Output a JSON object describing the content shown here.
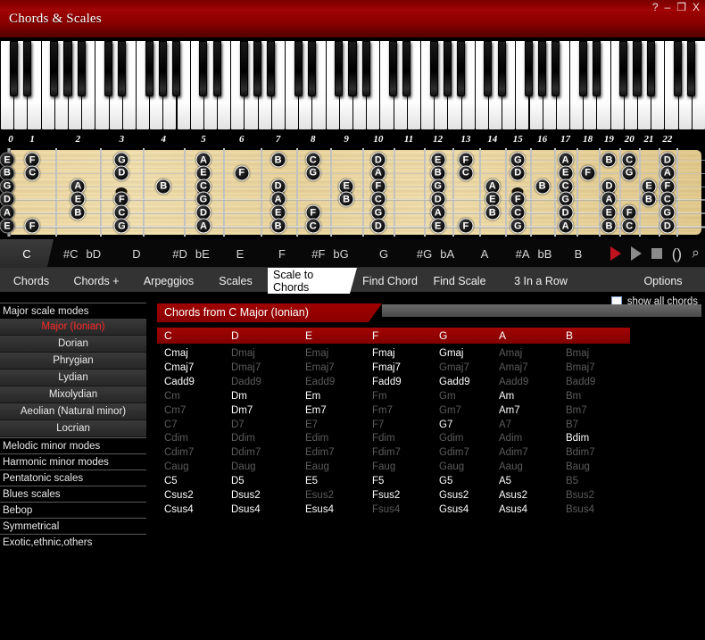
{
  "window": {
    "title": "Chords & Scales",
    "buttons": [
      {
        "name": "help-button",
        "glyph": "?"
      },
      {
        "name": "minimize-button",
        "glyph": "–"
      },
      {
        "name": "maximize-button",
        "glyph": "❐"
      },
      {
        "name": "close-button",
        "glyph": "X"
      }
    ]
  },
  "fretboard": {
    "fret_numbers": [
      "0",
      "1",
      "2",
      "3",
      "4",
      "5",
      "6",
      "7",
      "8",
      "9",
      "10",
      "11",
      "12",
      "13",
      "14",
      "15",
      "16",
      "17",
      "18",
      "19",
      "20",
      "21",
      "22"
    ],
    "strings": [
      "E",
      "B",
      "G",
      "D",
      "A",
      "E"
    ],
    "notes": [
      {
        "string": 0,
        "fret": 0,
        "label": "E"
      },
      {
        "string": 1,
        "fret": 0,
        "label": "B"
      },
      {
        "string": 2,
        "fret": 0,
        "label": "G"
      },
      {
        "string": 3,
        "fret": 0,
        "label": "D"
      },
      {
        "string": 4,
        "fret": 0,
        "label": "A"
      },
      {
        "string": 5,
        "fret": 0,
        "label": "E"
      },
      {
        "string": 0,
        "fret": 1,
        "label": "F"
      },
      {
        "string": 1,
        "fret": 1,
        "label": "C"
      },
      {
        "string": 5,
        "fret": 1,
        "label": "F"
      },
      {
        "string": 2,
        "fret": 2,
        "label": "A"
      },
      {
        "string": 3,
        "fret": 2,
        "label": "E"
      },
      {
        "string": 4,
        "fret": 2,
        "label": "B"
      },
      {
        "string": 0,
        "fret": 3,
        "label": "G"
      },
      {
        "string": 1,
        "fret": 3,
        "label": "D"
      },
      {
        "string": 3,
        "fret": 3,
        "label": "F"
      },
      {
        "string": 4,
        "fret": 3,
        "label": "C"
      },
      {
        "string": 5,
        "fret": 3,
        "label": "G"
      },
      {
        "string": 2,
        "fret": 4,
        "label": "B"
      },
      {
        "string": 0,
        "fret": 5,
        "label": "A"
      },
      {
        "string": 1,
        "fret": 5,
        "label": "E"
      },
      {
        "string": 2,
        "fret": 5,
        "label": "C"
      },
      {
        "string": 3,
        "fret": 5,
        "label": "G"
      },
      {
        "string": 4,
        "fret": 5,
        "label": "D"
      },
      {
        "string": 5,
        "fret": 5,
        "label": "A"
      },
      {
        "string": 1,
        "fret": 6,
        "label": "F"
      },
      {
        "string": 0,
        "fret": 7,
        "label": "B"
      },
      {
        "string": 2,
        "fret": 7,
        "label": "D"
      },
      {
        "string": 3,
        "fret": 7,
        "label": "A"
      },
      {
        "string": 4,
        "fret": 7,
        "label": "E"
      },
      {
        "string": 5,
        "fret": 7,
        "label": "B"
      },
      {
        "string": 0,
        "fret": 8,
        "label": "C"
      },
      {
        "string": 1,
        "fret": 8,
        "label": "G"
      },
      {
        "string": 4,
        "fret": 8,
        "label": "F"
      },
      {
        "string": 5,
        "fret": 8,
        "label": "C"
      },
      {
        "string": 2,
        "fret": 9,
        "label": "E"
      },
      {
        "string": 3,
        "fret": 9,
        "label": "B"
      },
      {
        "string": 0,
        "fret": 10,
        "label": "D"
      },
      {
        "string": 1,
        "fret": 10,
        "label": "A"
      },
      {
        "string": 2,
        "fret": 10,
        "label": "F"
      },
      {
        "string": 3,
        "fret": 10,
        "label": "C"
      },
      {
        "string": 4,
        "fret": 10,
        "label": "G"
      },
      {
        "string": 5,
        "fret": 10,
        "label": "D"
      },
      {
        "string": 0,
        "fret": 12,
        "label": "E"
      },
      {
        "string": 1,
        "fret": 12,
        "label": "B"
      },
      {
        "string": 2,
        "fret": 12,
        "label": "G"
      },
      {
        "string": 3,
        "fret": 12,
        "label": "D"
      },
      {
        "string": 4,
        "fret": 12,
        "label": "A"
      },
      {
        "string": 5,
        "fret": 12,
        "label": "E"
      },
      {
        "string": 0,
        "fret": 13,
        "label": "F"
      },
      {
        "string": 1,
        "fret": 13,
        "label": "C"
      },
      {
        "string": 5,
        "fret": 13,
        "label": "F"
      },
      {
        "string": 2,
        "fret": 14,
        "label": "A"
      },
      {
        "string": 3,
        "fret": 14,
        "label": "E"
      },
      {
        "string": 4,
        "fret": 14,
        "label": "B"
      },
      {
        "string": 0,
        "fret": 15,
        "label": "G"
      },
      {
        "string": 1,
        "fret": 15,
        "label": "D"
      },
      {
        "string": 3,
        "fret": 15,
        "label": "F"
      },
      {
        "string": 4,
        "fret": 15,
        "label": "C"
      },
      {
        "string": 5,
        "fret": 15,
        "label": "G"
      },
      {
        "string": 2,
        "fret": 16,
        "label": "B"
      },
      {
        "string": 0,
        "fret": 17,
        "label": "A"
      },
      {
        "string": 1,
        "fret": 17,
        "label": "E"
      },
      {
        "string": 2,
        "fret": 17,
        "label": "C"
      },
      {
        "string": 3,
        "fret": 17,
        "label": "G"
      },
      {
        "string": 4,
        "fret": 17,
        "label": "D"
      },
      {
        "string": 5,
        "fret": 17,
        "label": "A"
      },
      {
        "string": 1,
        "fret": 18,
        "label": "F"
      },
      {
        "string": 0,
        "fret": 19,
        "label": "B"
      },
      {
        "string": 2,
        "fret": 19,
        "label": "D"
      },
      {
        "string": 3,
        "fret": 19,
        "label": "A"
      },
      {
        "string": 4,
        "fret": 19,
        "label": "E"
      },
      {
        "string": 5,
        "fret": 19,
        "label": "B"
      },
      {
        "string": 0,
        "fret": 20,
        "label": "C"
      },
      {
        "string": 1,
        "fret": 20,
        "label": "G"
      },
      {
        "string": 4,
        "fret": 20,
        "label": "F"
      },
      {
        "string": 5,
        "fret": 20,
        "label": "C"
      },
      {
        "string": 2,
        "fret": 21,
        "label": "E"
      },
      {
        "string": 3,
        "fret": 21,
        "label": "B"
      },
      {
        "string": 0,
        "fret": 22,
        "label": "D"
      },
      {
        "string": 1,
        "fret": 22,
        "label": "A"
      },
      {
        "string": 2,
        "fret": 22,
        "label": "F"
      },
      {
        "string": 3,
        "fret": 22,
        "label": "C"
      },
      {
        "string": 4,
        "fret": 22,
        "label": "G"
      },
      {
        "string": 5,
        "fret": 22,
        "label": "D"
      }
    ],
    "inlay_frets": [
      3,
      5,
      7,
      9,
      15,
      17,
      19,
      21
    ],
    "double_inlay_frets": [
      12
    ]
  },
  "keybar": {
    "selected": "C",
    "keys": [
      {
        "main": "C",
        "alt": ""
      },
      {
        "main": "#C",
        "alt": "bD"
      },
      {
        "main": "D",
        "alt": ""
      },
      {
        "main": "#D",
        "alt": "bE"
      },
      {
        "main": "E",
        "alt": ""
      },
      {
        "main": "F",
        "alt": ""
      },
      {
        "main": "#F",
        "alt": "bG"
      },
      {
        "main": "G",
        "alt": ""
      },
      {
        "main": "#G",
        "alt": "bA"
      },
      {
        "main": "A",
        "alt": ""
      },
      {
        "main": "#A",
        "alt": "bB"
      },
      {
        "main": "B",
        "alt": ""
      }
    ],
    "transport": [
      {
        "name": "play-red-button",
        "icon": "play-icon"
      },
      {
        "name": "play-button",
        "icon": "play-icon"
      },
      {
        "name": "stop-button",
        "icon": "stop-icon"
      },
      {
        "name": "loop-button",
        "icon": "loop-icon",
        "glyph": "()"
      },
      {
        "name": "zoom-button",
        "icon": "magnifier-icon",
        "glyph": "⌕"
      }
    ]
  },
  "navtabs": {
    "selected": "Scale to Chords",
    "items": [
      {
        "label": "Chords"
      },
      {
        "label": "Chords +"
      },
      {
        "label": "Arpeggios"
      },
      {
        "label": "Scales"
      },
      {
        "label": "Scale to Chords"
      },
      {
        "label": "Find Chord"
      },
      {
        "label": "Find Scale"
      },
      {
        "label": "3 In a Row"
      },
      {
        "label": "Options"
      }
    ]
  },
  "show_all_chords": {
    "label": "show all chords",
    "checked": false
  },
  "sidebar": {
    "groups": [
      {
        "label": "Major scale modes",
        "type": "group"
      },
      {
        "label": "Major (Ionian)",
        "type": "mode",
        "selected": true
      },
      {
        "label": "Dorian",
        "type": "mode",
        "selected": false
      },
      {
        "label": "Phrygian",
        "type": "mode",
        "selected": false
      },
      {
        "label": "Lydian",
        "type": "mode",
        "selected": false
      },
      {
        "label": "Mixolydian",
        "type": "mode",
        "selected": false
      },
      {
        "label": "Aeolian (Natural minor)",
        "type": "mode",
        "selected": false
      },
      {
        "label": "Locrian",
        "type": "mode",
        "selected": false
      },
      {
        "label": "Melodic minor modes",
        "type": "group"
      },
      {
        "label": "Harmonic minor modes",
        "type": "group"
      },
      {
        "label": "Pentatonic scales",
        "type": "group"
      },
      {
        "label": "Blues scales",
        "type": "group"
      },
      {
        "label": "Bebop",
        "type": "group"
      },
      {
        "label": "Symmetrical",
        "type": "group"
      },
      {
        "label": "Exotic,ethnic,others",
        "type": "group"
      }
    ]
  },
  "chords_panel": {
    "title": "Chords from C Major (Ionian)",
    "columns": [
      "C",
      "D",
      "E",
      "F",
      "G",
      "A",
      "B"
    ],
    "rows": [
      {
        "suffix": "maj",
        "cells": [
          {
            "t": "Cmaj",
            "on": true
          },
          {
            "t": "Dmaj",
            "on": false
          },
          {
            "t": "Emaj",
            "on": false
          },
          {
            "t": "Fmaj",
            "on": true
          },
          {
            "t": "Gmaj",
            "on": true
          },
          {
            "t": "Amaj",
            "on": false
          },
          {
            "t": "Bmaj",
            "on": false
          }
        ]
      },
      {
        "suffix": "maj7",
        "cells": [
          {
            "t": "Cmaj7",
            "on": true
          },
          {
            "t": "Dmaj7",
            "on": false
          },
          {
            "t": "Emaj7",
            "on": false
          },
          {
            "t": "Fmaj7",
            "on": true
          },
          {
            "t": "Gmaj7",
            "on": false
          },
          {
            "t": "Amaj7",
            "on": false
          },
          {
            "t": "Bmaj7",
            "on": false
          }
        ]
      },
      {
        "suffix": "add9",
        "cells": [
          {
            "t": "Cadd9",
            "on": true
          },
          {
            "t": "Dadd9",
            "on": false
          },
          {
            "t": "Eadd9",
            "on": false
          },
          {
            "t": "Fadd9",
            "on": true
          },
          {
            "t": "Gadd9",
            "on": true
          },
          {
            "t": "Aadd9",
            "on": false
          },
          {
            "t": "Badd9",
            "on": false
          }
        ]
      },
      {
        "suffix": "m",
        "cells": [
          {
            "t": "Cm",
            "on": false
          },
          {
            "t": "Dm",
            "on": true
          },
          {
            "t": "Em",
            "on": true
          },
          {
            "t": "Fm",
            "on": false
          },
          {
            "t": "Gm",
            "on": false
          },
          {
            "t": "Am",
            "on": true
          },
          {
            "t": "Bm",
            "on": false
          }
        ]
      },
      {
        "suffix": "m7",
        "cells": [
          {
            "t": "Cm7",
            "on": false
          },
          {
            "t": "Dm7",
            "on": true
          },
          {
            "t": "Em7",
            "on": true
          },
          {
            "t": "Fm7",
            "on": false
          },
          {
            "t": "Gm7",
            "on": false
          },
          {
            "t": "Am7",
            "on": true
          },
          {
            "t": "Bm7",
            "on": false
          }
        ]
      },
      {
        "suffix": "7",
        "cells": [
          {
            "t": "C7",
            "on": false
          },
          {
            "t": "D7",
            "on": false
          },
          {
            "t": "E7",
            "on": false
          },
          {
            "t": "F7",
            "on": false
          },
          {
            "t": "G7",
            "on": true
          },
          {
            "t": "A7",
            "on": false
          },
          {
            "t": "B7",
            "on": false
          }
        ]
      },
      {
        "suffix": "dim",
        "cells": [
          {
            "t": "Cdim",
            "on": false
          },
          {
            "t": "Ddim",
            "on": false
          },
          {
            "t": "Edim",
            "on": false
          },
          {
            "t": "Fdim",
            "on": false
          },
          {
            "t": "Gdim",
            "on": false
          },
          {
            "t": "Adim",
            "on": false
          },
          {
            "t": "Bdim",
            "on": true
          }
        ]
      },
      {
        "suffix": "dim7",
        "cells": [
          {
            "t": "Cdim7",
            "on": false
          },
          {
            "t": "Ddim7",
            "on": false
          },
          {
            "t": "Edim7",
            "on": false
          },
          {
            "t": "Fdim7",
            "on": false
          },
          {
            "t": "Gdim7",
            "on": false
          },
          {
            "t": "Adim7",
            "on": false
          },
          {
            "t": "Bdim7",
            "on": false
          }
        ]
      },
      {
        "suffix": "aug",
        "cells": [
          {
            "t": "Caug",
            "on": false
          },
          {
            "t": "Daug",
            "on": false
          },
          {
            "t": "Eaug",
            "on": false
          },
          {
            "t": "Faug",
            "on": false
          },
          {
            "t": "Gaug",
            "on": false
          },
          {
            "t": "Aaug",
            "on": false
          },
          {
            "t": "Baug",
            "on": false
          }
        ]
      },
      {
        "suffix": "5",
        "cells": [
          {
            "t": "C5",
            "on": true
          },
          {
            "t": "D5",
            "on": true
          },
          {
            "t": "E5",
            "on": true
          },
          {
            "t": "F5",
            "on": true
          },
          {
            "t": "G5",
            "on": true
          },
          {
            "t": "A5",
            "on": true
          },
          {
            "t": "B5",
            "on": false
          }
        ]
      },
      {
        "suffix": "sus2",
        "cells": [
          {
            "t": "Csus2",
            "on": true
          },
          {
            "t": "Dsus2",
            "on": true
          },
          {
            "t": "Esus2",
            "on": false
          },
          {
            "t": "Fsus2",
            "on": true
          },
          {
            "t": "Gsus2",
            "on": true
          },
          {
            "t": "Asus2",
            "on": true
          },
          {
            "t": "Bsus2",
            "on": false
          }
        ]
      },
      {
        "suffix": "sus4",
        "cells": [
          {
            "t": "Csus4",
            "on": true
          },
          {
            "t": "Dsus4",
            "on": true
          },
          {
            "t": "Esus4",
            "on": true
          },
          {
            "t": "Fsus4",
            "on": false
          },
          {
            "t": "Gsus4",
            "on": true
          },
          {
            "t": "Asus4",
            "on": true
          },
          {
            "t": "Bsus4",
            "on": false
          }
        ]
      }
    ]
  },
  "colors": {
    "brand_red": "#8a0000",
    "accent_red": "#a20505",
    "selected_mode": "#ff2a2a",
    "wood": "#ecd8a2"
  }
}
